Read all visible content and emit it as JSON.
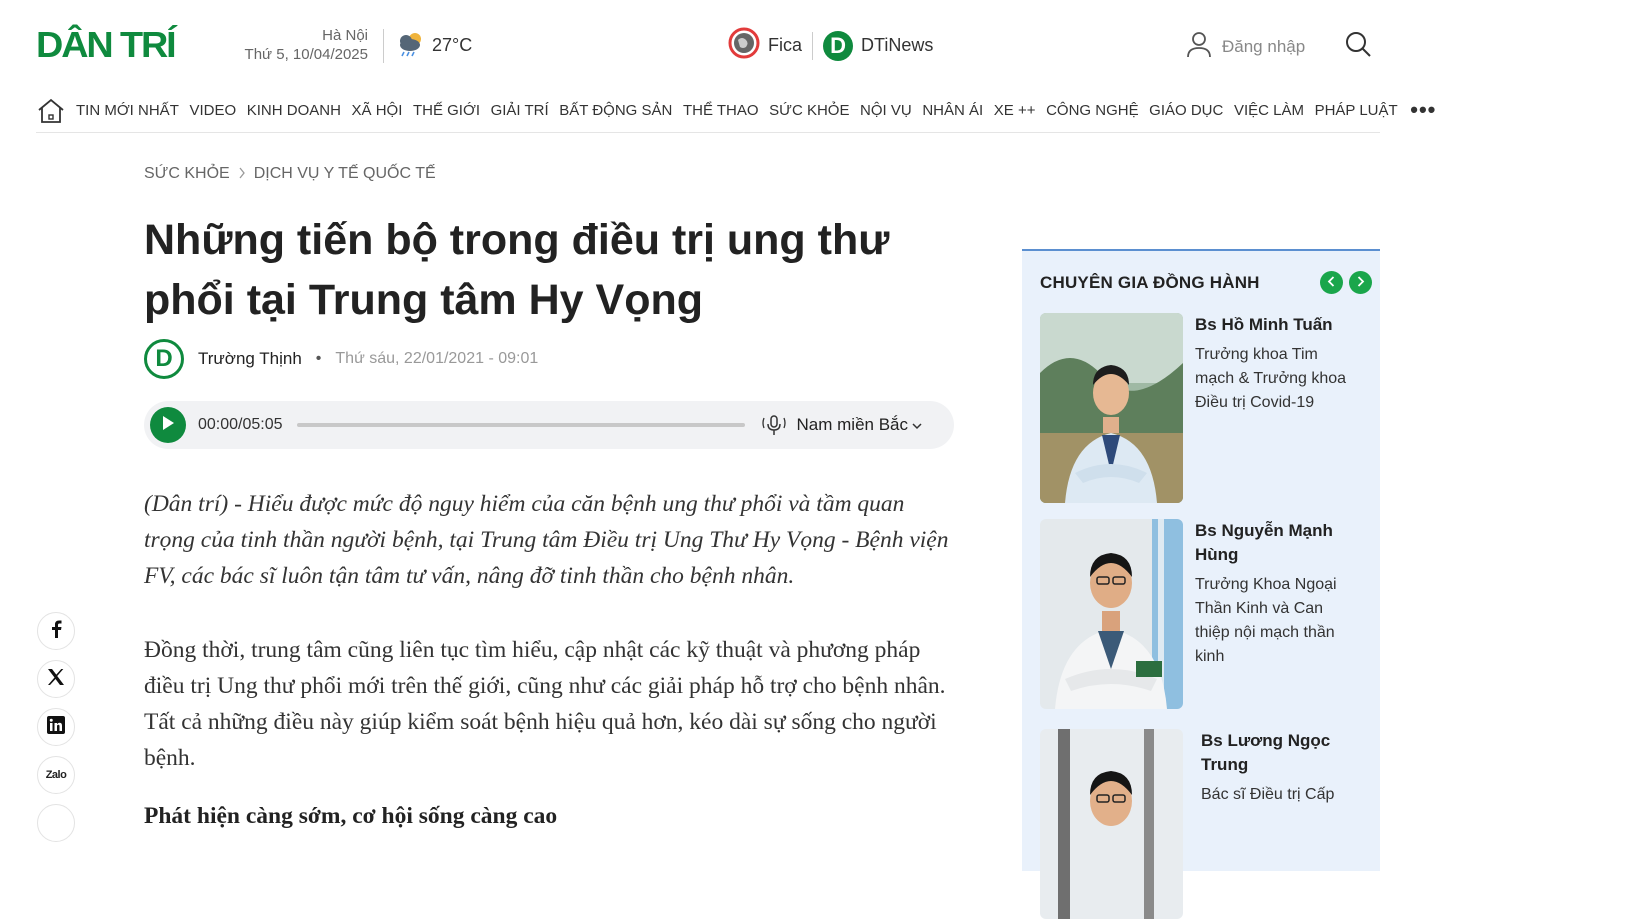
{
  "header": {
    "logo_text": "DÂN TRÍ",
    "location": "Hà Nội",
    "date": "Thứ 5, 10/04/2025",
    "temperature": "27°C",
    "partners": [
      {
        "label": "Fica",
        "icon": "globe-icon"
      },
      {
        "label": "DTiNews",
        "icon": "dtinews-logo-icon"
      }
    ],
    "login_label": "Đăng nhập"
  },
  "nav": {
    "items": [
      "TIN MỚI NHẤT",
      "VIDEO",
      "KINH DOANH",
      "XÃ HỘI",
      "THẾ GIỚI",
      "GIẢI TRÍ",
      "BẤT ĐỘNG SẢN",
      "THỂ THAO",
      "SỨC KHỎE",
      "NỘI VỤ",
      "NHÂN ÁI",
      "XE ++",
      "CÔNG NGHỆ",
      "GIÁO DỤC",
      "VIỆC LÀM",
      "PHÁP LUẬT"
    ],
    "more": "•••"
  },
  "breadcrumb": [
    "SỨC KHỎE",
    "DỊCH VỤ Y TẾ QUỐC TẾ"
  ],
  "article": {
    "title": "Những tiến bộ trong điều trị ung thư phổi tại Trung tâm Hy Vọng",
    "author_initial": "D",
    "author": "Trường Thịnh",
    "separator": "•",
    "published": "Thứ sáu, 22/01/2021 - 09:01",
    "audio": {
      "time": "00:00/05:05",
      "voice": "Nam miền Bắc",
      "progress": 0
    },
    "sapo": "(Dân trí) - Hiểu được mức độ nguy hiểm của căn bệnh ung thư phổi và tầm quan trọng của tinh thần người bệnh, tại Trung tâm Điều trị Ung Thư Hy Vọng - Bệnh viện FV, các bác sĩ luôn tận tâm tư vấn, nâng đỡ tinh thần cho bệnh nhân.",
    "paragraph": "Đồng thời, trung tâm cũng liên tục tìm hiểu, cập nhật các kỹ thuật và phương pháp điều trị Ung thư phổi mới trên thế giới, cũng như các giải pháp hỗ trợ cho bệnh nhân. Tất cả những điều này giúp kiểm soát bệnh hiệu quả hơn, kéo dài sự sống cho người bệnh.",
    "subheading": "Phát hiện càng sớm, cơ hội sống càng cao"
  },
  "share": {
    "zalo_label": "Zalo"
  },
  "sidebar": {
    "heading": "CHUYÊN GIA ĐỒNG HÀNH",
    "experts": [
      {
        "name": "Bs Hồ Minh Tuấn",
        "role": "Trưởng khoa Tim mạch & Trưởng khoa Điều trị Covid-19"
      },
      {
        "name": "Bs Nguyễn Mạnh Hùng",
        "role": "Trưởng Khoa Ngoại Thần Kinh và Can thiệp nội mạch thần kinh"
      },
      {
        "name": "Bs Lương Ngọc Trung",
        "role": "Bác sĩ Điều trị Cấp"
      }
    ]
  },
  "colors": {
    "brand_green": "#0f8a3e",
    "sidebar_bg": "#e9f1fb",
    "sidebar_border": "#5b8fd0"
  }
}
